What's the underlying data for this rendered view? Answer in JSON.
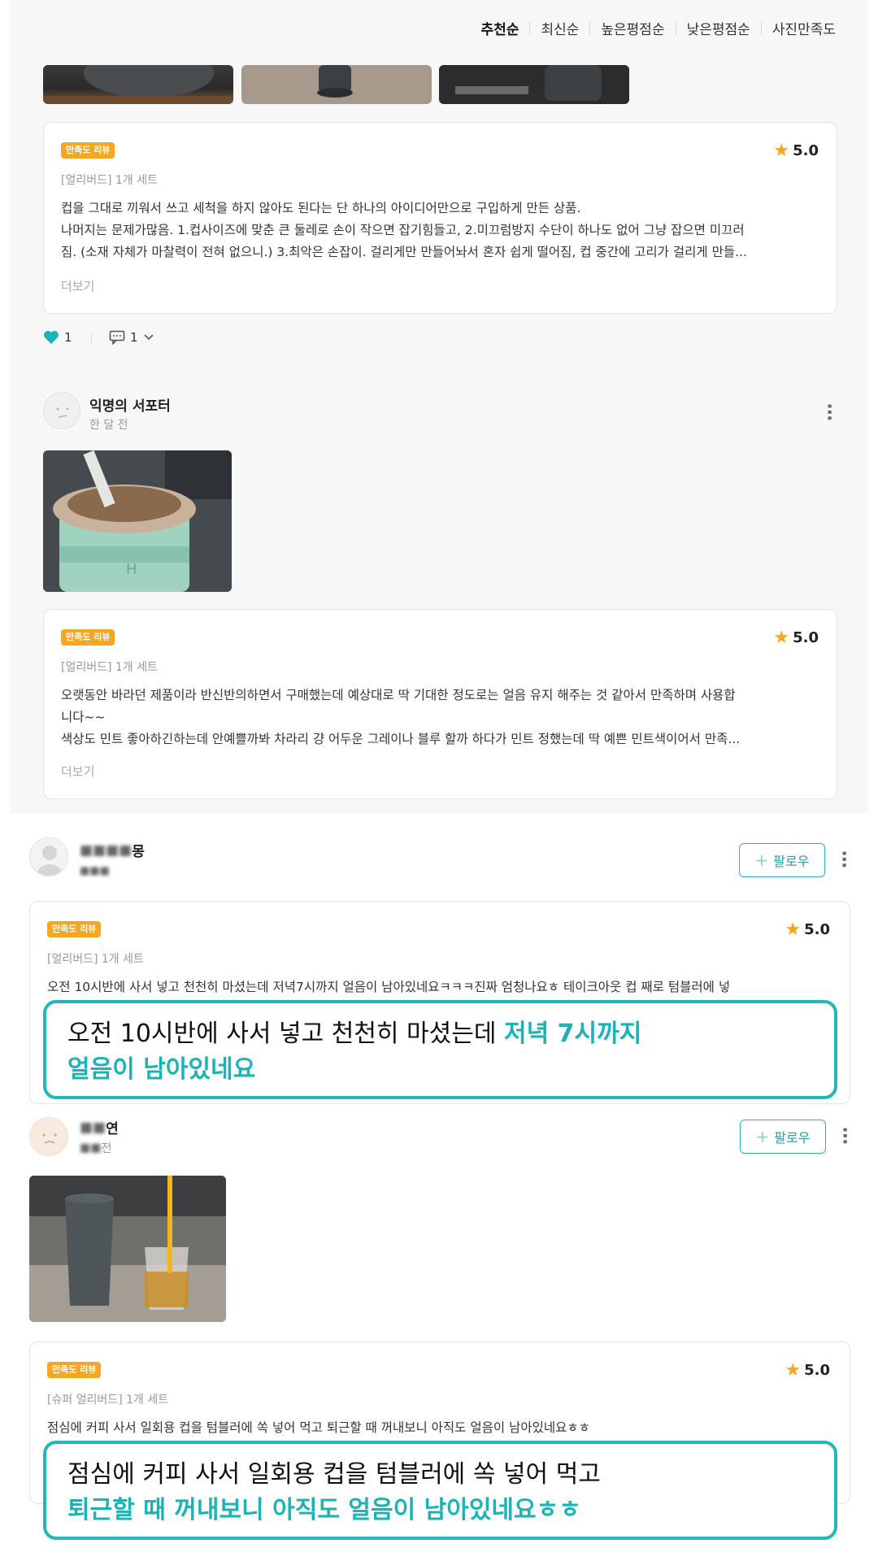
{
  "sort_tabs": [
    "추천순",
    "최신순",
    "높은평점순",
    "낮은평점순",
    "사진만족도"
  ],
  "reviews": [
    {
      "badge": "만족도 리뷰",
      "score": "5.0",
      "option": "[얼리버드] 1개 세트",
      "lines": [
        "컵을 그대로 끼워서 쓰고 세척을 하지 않아도 된다는 단 하나의 아이디어만으로 구입하게 만든 상품.",
        "나머지는 문제가많음. 1.컵사이즈에 맞춘 큰 둘레로 손이 작으면 잡기힘들고, 2.미끄럼방지 수단이 하나도 없어 그냥 잡으면 미끄러",
        "짐. (소재 자체가 마찰력이 전혀 없으니.) 3.최악은 손잡이. 걸리게만 만들어놔서 혼자 쉽게 떨어짐, 컵 중간에 고리가 걸리게 만들..."
      ],
      "more": "더보기",
      "likes": "1",
      "comments": "1"
    },
    {
      "user": "익명의 서포터",
      "time": "한 달 전",
      "badge": "만족도 리뷰",
      "score": "5.0",
      "option": "[얼리버드] 1개 세트",
      "lines": [
        "오랫동안 바라던 제품이라 반신반의하면서 구매했는데 예상대로 딱 기대한 정도로는 얼음 유지 해주는 것 같아서 만족하며 사용합",
        "니다~~",
        "색상도 민트 좋아하긴하는데 안예쁠까봐 차라리 걍 어두운 그레이나 블루 할까 하다가 민트 정했는데 딱 예쁜 민트색이어서 만족..."
      ],
      "more": "더보기"
    },
    {
      "user_suffix": "몽",
      "follow": "팔로우",
      "badge": "만족도 리뷰",
      "score": "5.0",
      "option": "[얼리버드] 1개 세트",
      "line": "오전 10시반에 사서 넣고 천천히 마셨는데 저녁7시까지 얼음이 남아있네요ㅋㅋㅋ진짜 엄청나요ㅎ 테이크아웃 컵 째로 텀블러에 넣",
      "highlight_plain": "오전 10시반에 사서 넣고 천천히 마셨는데 ",
      "highlight_teal_1": "저녁 7시까지",
      "highlight_teal_2": "얼음이 남아있네요"
    },
    {
      "user_suffix": "연",
      "time_suffix": "전",
      "follow": "팔로우",
      "badge": "만족도 리뷰",
      "score": "5.0",
      "option": "[슈퍼 얼리버드] 1개 세트",
      "line": "점심에 커피 사서 일회용 컵을 텀블러에 쏙 넣어 먹고 퇴근할 때 꺼내보니 아직도 얼음이 남아있네요ㅎㅎ",
      "highlight_plain": "점심에 커피 사서 일회용 컵을 텀블러에 쏙 넣어 먹고",
      "highlight_teal": "퇴근할 때 꺼내보니 아직도 얼음이 남아있네요ㅎㅎ"
    }
  ],
  "colors": {
    "accent": "#1cb3b6",
    "badge": "#f5a623",
    "star": "#f5a623"
  },
  "icons": [
    "heart-icon",
    "comment-icon",
    "chevron-down-icon",
    "star-icon",
    "kebab-menu-icon",
    "plus-icon",
    "avatar-icon"
  ]
}
